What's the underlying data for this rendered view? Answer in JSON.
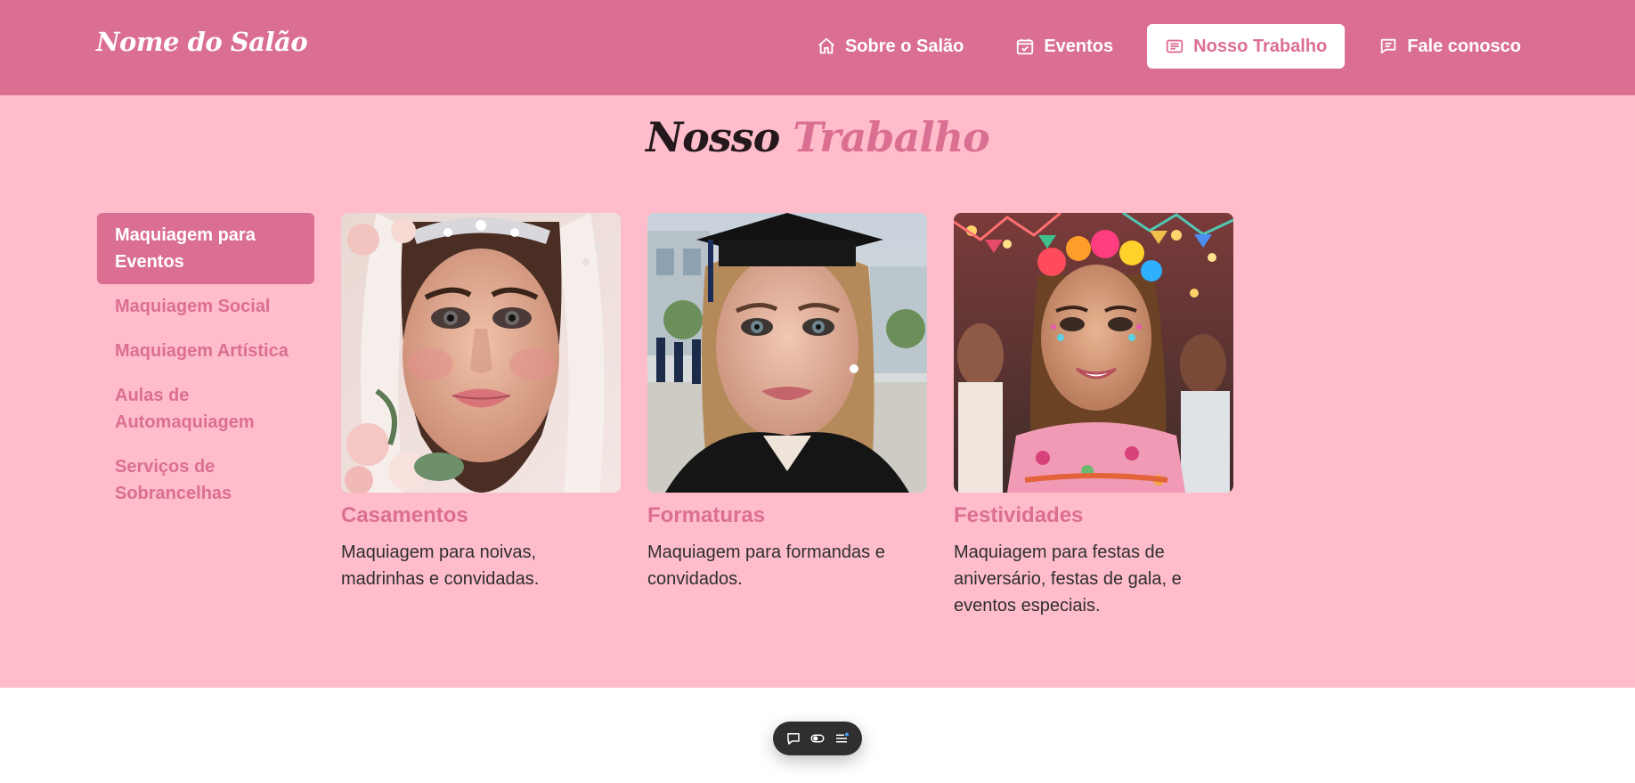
{
  "brand": "Nome do Salão",
  "nav": [
    {
      "label": "Sobre o Salão",
      "icon": "home-icon"
    },
    {
      "label": "Eventos",
      "icon": "calendar-check-icon"
    },
    {
      "label": "Nosso Trabalho",
      "icon": "newspaper-icon",
      "active": true
    },
    {
      "label": "Fale conosco",
      "icon": "chat-icon"
    }
  ],
  "section": {
    "title_part1": "Nosso",
    "title_part2": "Trabalho"
  },
  "sidebar": {
    "items": [
      {
        "label": "Maquiagem para Eventos",
        "active": true
      },
      {
        "label": "Maquiagem Social"
      },
      {
        "label": "Maquiagem Artística"
      },
      {
        "label": "Aulas de Automaquiagem"
      },
      {
        "label": "Serviços de Sobrancelhas"
      }
    ]
  },
  "cards": [
    {
      "title": "Casamentos",
      "desc": "Maquiagem para noivas, madrinhas e convidadas."
    },
    {
      "title": "Formaturas",
      "desc": "Maquiagem para formandas e convidados."
    },
    {
      "title": "Festividades",
      "desc": "Maquiagem para festas de aniversário, festas de gala, e eventos especiais."
    }
  ],
  "toolbar": {
    "icons": [
      "comment-icon",
      "toggle-icon",
      "menu-icon"
    ]
  },
  "colors": {
    "primary": "#db6f91",
    "background": "#ffbdcb",
    "title_dark": "#24181c"
  }
}
